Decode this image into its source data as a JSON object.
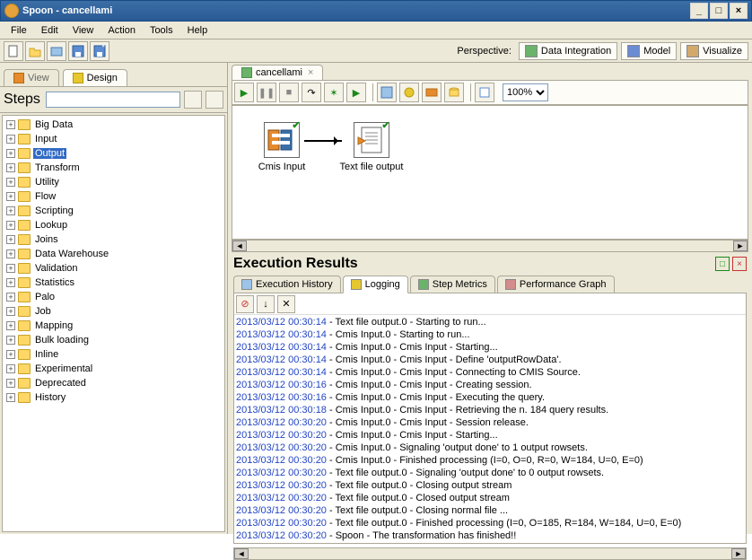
{
  "window": {
    "title": "Spoon - cancellami"
  },
  "menu": [
    "File",
    "Edit",
    "View",
    "Action",
    "Tools",
    "Help"
  ],
  "perspective": {
    "label": "Perspective:",
    "buttons": [
      "Data Integration",
      "Model",
      "Visualize"
    ]
  },
  "left_tabs": {
    "view": "View",
    "design": "Design"
  },
  "steps": {
    "title": "Steps",
    "filter_placeholder": "",
    "items": [
      {
        "label": "Big Data",
        "selected": false
      },
      {
        "label": "Input",
        "selected": false
      },
      {
        "label": "Output",
        "selected": true
      },
      {
        "label": "Transform",
        "selected": false
      },
      {
        "label": "Utility",
        "selected": false
      },
      {
        "label": "Flow",
        "selected": false
      },
      {
        "label": "Scripting",
        "selected": false
      },
      {
        "label": "Lookup",
        "selected": false
      },
      {
        "label": "Joins",
        "selected": false
      },
      {
        "label": "Data Warehouse",
        "selected": false
      },
      {
        "label": "Validation",
        "selected": false
      },
      {
        "label": "Statistics",
        "selected": false
      },
      {
        "label": "Palo",
        "selected": false
      },
      {
        "label": "Job",
        "selected": false
      },
      {
        "label": "Mapping",
        "selected": false
      },
      {
        "label": "Bulk loading",
        "selected": false
      },
      {
        "label": "Inline",
        "selected": false
      },
      {
        "label": "Experimental",
        "selected": false
      },
      {
        "label": "Deprecated",
        "selected": false
      },
      {
        "label": "History",
        "selected": false
      }
    ]
  },
  "right_tab": {
    "label": "cancellami"
  },
  "zoom": "100%",
  "canvas_steps": {
    "cmis": "Cmis Input",
    "tfo": "Text file output"
  },
  "exec": {
    "title": "Execution Results",
    "tabs": [
      "Execution History",
      "Logging",
      "Step Metrics",
      "Performance Graph"
    ],
    "active_tab": 1,
    "log": [
      {
        "ts": "2013/03/12 00:30:14",
        "msg": "Text file output.0 - Starting to run..."
      },
      {
        "ts": "2013/03/12 00:30:14",
        "msg": "Cmis Input.0 - Starting to run..."
      },
      {
        "ts": "2013/03/12 00:30:14",
        "msg": "Cmis Input.0 - Cmis Input - Starting..."
      },
      {
        "ts": "2013/03/12 00:30:14",
        "msg": "Cmis Input.0 - Cmis Input - Define 'outputRowData'."
      },
      {
        "ts": "2013/03/12 00:30:14",
        "msg": "Cmis Input.0 - Cmis Input - Connecting to CMIS Source."
      },
      {
        "ts": "2013/03/12 00:30:16",
        "msg": "Cmis Input.0 - Cmis Input - Creating session."
      },
      {
        "ts": "2013/03/12 00:30:16",
        "msg": "Cmis Input.0 - Cmis Input - Executing the query."
      },
      {
        "ts": "2013/03/12 00:30:18",
        "msg": "Cmis Input.0 - Cmis Input - Retrieving the n. 184 query results."
      },
      {
        "ts": "2013/03/12 00:30:20",
        "msg": "Cmis Input.0 - Cmis Input - Session release."
      },
      {
        "ts": "2013/03/12 00:30:20",
        "msg": "Cmis Input.0 - Cmis Input - Starting..."
      },
      {
        "ts": "2013/03/12 00:30:20",
        "msg": "Cmis Input.0 - Signaling 'output done' to 1 output rowsets."
      },
      {
        "ts": "2013/03/12 00:30:20",
        "msg": "Cmis Input.0 - Finished processing (I=0, O=0, R=0, W=184, U=0, E=0)"
      },
      {
        "ts": "2013/03/12 00:30:20",
        "msg": "Text file output.0 - Signaling 'output done' to 0 output rowsets."
      },
      {
        "ts": "2013/03/12 00:30:20",
        "msg": "Text file output.0 - Closing output stream"
      },
      {
        "ts": "2013/03/12 00:30:20",
        "msg": "Text file output.0 - Closed output stream"
      },
      {
        "ts": "2013/03/12 00:30:20",
        "msg": "Text file output.0 - Closing normal file ..."
      },
      {
        "ts": "2013/03/12 00:30:20",
        "msg": "Text file output.0 - Finished processing (I=0, O=185, R=184, W=184, U=0, E=0)"
      },
      {
        "ts": "2013/03/12 00:30:20",
        "msg": "Spoon - The transformation has finished!!"
      }
    ]
  }
}
